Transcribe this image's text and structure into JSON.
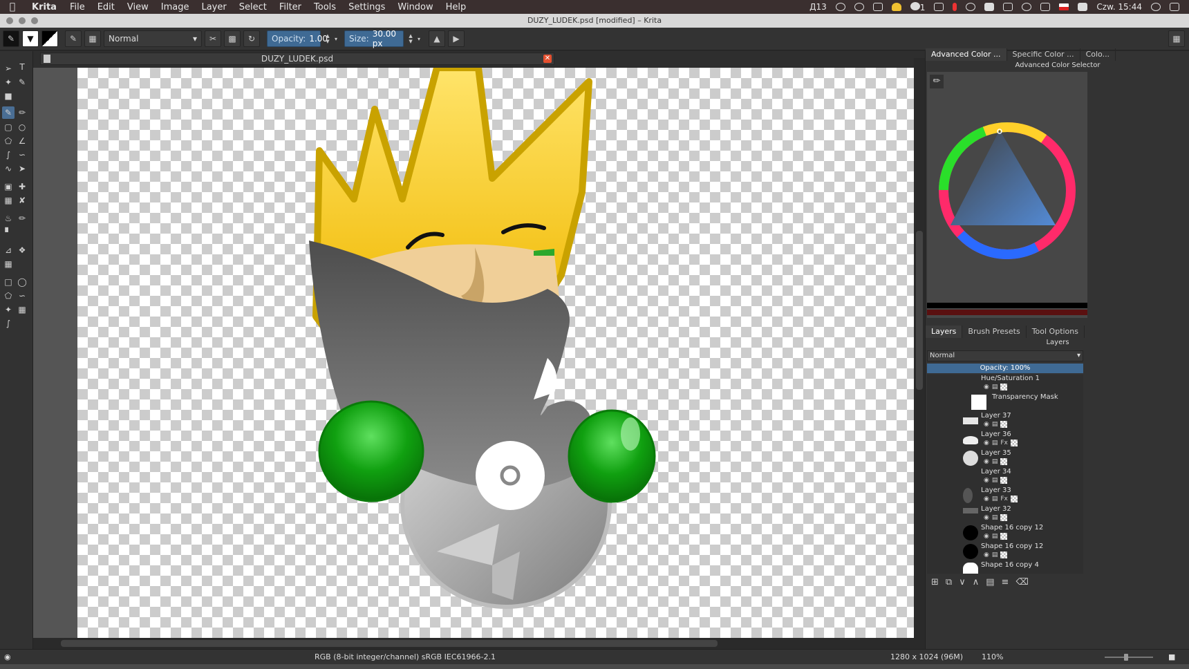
{
  "menubar": {
    "app_name": "Krita",
    "items": [
      "File",
      "Edit",
      "View",
      "Image",
      "Layer",
      "Select",
      "Filter",
      "Tools",
      "Settings",
      "Window",
      "Help"
    ],
    "status_count": "13",
    "notification_count": "1",
    "clock": "Czw. 15:44"
  },
  "window": {
    "title": "DUZY_LUDEK.psd [modified] – Krita"
  },
  "toolbar": {
    "blend_mode": "Normal",
    "opacity_label": "Opacity:",
    "opacity_value": "1.00",
    "size_label": "Size:",
    "size_value": "30.00 px"
  },
  "document": {
    "tab_title": "DUZY_LUDEK.psd"
  },
  "dockers": {
    "top_tabs": [
      "Advanced Color ...",
      "Specific Color ...",
      "Colo..."
    ],
    "color_selector_title": "Advanced Color Selector",
    "bottom_tabs": [
      "Layers",
      "Brush Presets",
      "Tool Options"
    ],
    "layers_title": "Layers",
    "layers_blend": "Normal",
    "layers_opacity": "Opacity:  100%",
    "layers": [
      {
        "name": "Hue/Saturation 1",
        "props": ""
      },
      {
        "name": "Transparency Mask",
        "props": ""
      },
      {
        "name": "Layer 37",
        "props": ""
      },
      {
        "name": "Layer 36",
        "props": "Fx"
      },
      {
        "name": "Layer 35",
        "props": ""
      },
      {
        "name": "Layer 34",
        "props": ""
      },
      {
        "name": "Layer 33",
        "props": "Fx"
      },
      {
        "name": "Layer 32",
        "props": ""
      },
      {
        "name": "Shape 16 copy 12",
        "props": ""
      },
      {
        "name": "Shape 16 copy 12",
        "props": ""
      },
      {
        "name": "Shape 16 copy 4",
        "props": ""
      }
    ]
  },
  "statusbar": {
    "color_space": "RGB (8-bit integer/channel)  sRGB IEC61966-2.1",
    "image_size": "1280 x 1024 (96M)",
    "zoom": "110%"
  },
  "colors": {
    "accent": "#3f6a94",
    "crown_yellow": "#f2c200",
    "glove_green": "#12a012",
    "body_gray": "#5f5f5f"
  }
}
